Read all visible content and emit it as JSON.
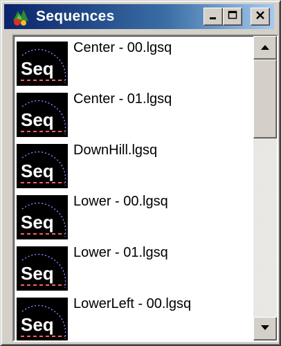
{
  "window": {
    "title": "Sequences",
    "controls": {
      "minimize": "minimize-icon",
      "maximize": "maximize-icon",
      "close": "close-icon"
    }
  },
  "list": {
    "thumbnail_text": "Seq",
    "items": [
      {
        "label": "Center - 00.lgsq"
      },
      {
        "label": "Center - 01.lgsq"
      },
      {
        "label": "DownHill.lgsq"
      },
      {
        "label": "Lower - 00.lgsq"
      },
      {
        "label": "Lower - 01.lgsq"
      },
      {
        "label": "LowerLeft - 00.lgsq"
      }
    ]
  },
  "scrollbar": {
    "up_icon": "arrow-up-icon",
    "down_icon": "arrow-down-icon"
  },
  "colors": {
    "titlebar_start": "#0a246a",
    "titlebar_end": "#a6caf0",
    "thumbnail_bg": "#000000",
    "thumbnail_dash": "#ff6060",
    "thumbnail_curve": "#8080ff"
  }
}
